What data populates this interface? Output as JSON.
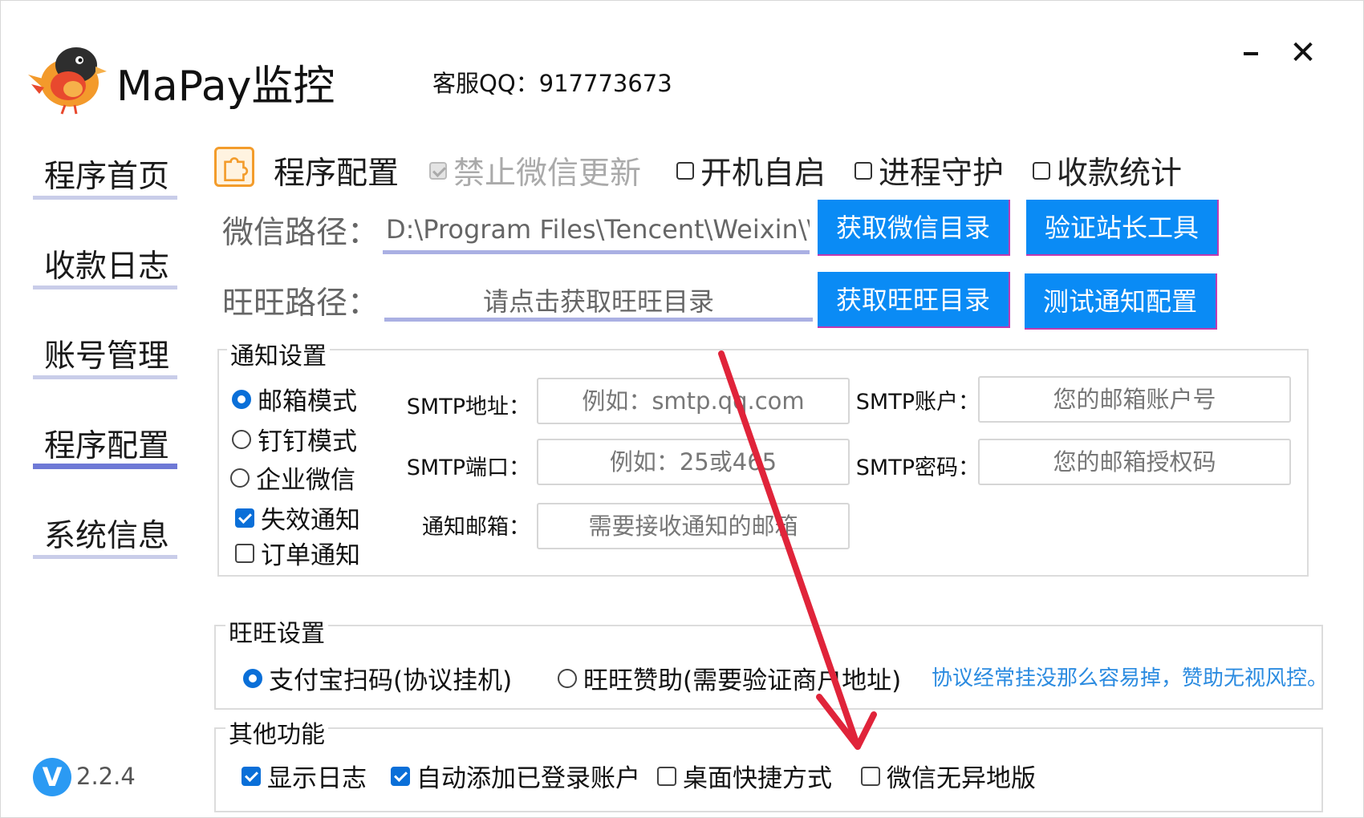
{
  "header": {
    "app_title": "MaPay监控",
    "qq": "客服QQ：917773673"
  },
  "sidebar": {
    "items": [
      {
        "label": "程序首页"
      },
      {
        "label": "收款日志"
      },
      {
        "label": "账号管理"
      },
      {
        "label": "程序配置",
        "active": true
      },
      {
        "label": "系统信息"
      }
    ],
    "version": "2.2.4",
    "version_icon": "V"
  },
  "config": {
    "title": "程序配置",
    "top_options": [
      {
        "label": "禁止微信更新",
        "checked": true,
        "disabled": true
      },
      {
        "label": "开机自启",
        "checked": false
      },
      {
        "label": "进程守护",
        "checked": false
      },
      {
        "label": "收款统计",
        "checked": false
      }
    ],
    "wechat_path_label": "微信路径：",
    "wechat_path_value": "D:\\Program Files\\Tencent\\Weixin\\\\",
    "wangwang_path_label": "旺旺路径：",
    "wangwang_path_placeholder": "请点击获取旺旺目录",
    "buttons": {
      "get_wechat_dir": "获取微信目录",
      "verify_tool": "验证站长工具",
      "get_wangwang_dir": "获取旺旺目录",
      "test_notify": "测试通知配置"
    }
  },
  "notify": {
    "title": "通知设置",
    "modes": [
      {
        "label": "邮箱模式",
        "selected": true
      },
      {
        "label": "钉钉模式",
        "selected": false
      },
      {
        "label": "企业微信",
        "selected": false
      }
    ],
    "checks": [
      {
        "label": "失效通知",
        "checked": true
      },
      {
        "label": "订单通知",
        "checked": false
      }
    ],
    "fields": {
      "smtp_addr_label": "SMTP地址：",
      "smtp_addr_placeholder": "例如：smtp.qq.com",
      "smtp_port_label": "SMTP端口：",
      "smtp_port_placeholder": "例如：25或465",
      "notify_mail_label": "通知邮箱：",
      "notify_mail_placeholder": "需要接收通知的邮箱",
      "smtp_account_label": "SMTP账户：",
      "smtp_account_placeholder": "您的邮箱账户号",
      "smtp_password_label": "SMTP密码：",
      "smtp_password_placeholder": "您的邮箱授权码"
    }
  },
  "wangwang": {
    "title": "旺旺设置",
    "options": [
      {
        "label": "支付宝扫码(协议挂机)",
        "selected": true
      },
      {
        "label": "旺旺赞助(需要验证商户地址)",
        "selected": false
      }
    ],
    "note": "协议经常挂没那么容易掉，赞助无视风控。"
  },
  "other": {
    "title": "其他功能",
    "options": [
      {
        "label": "显示日志",
        "checked": true
      },
      {
        "label": "自动添加已登录账户",
        "checked": true
      },
      {
        "label": "桌面快捷方式",
        "checked": false
      },
      {
        "label": "微信无异地版",
        "checked": false
      }
    ]
  },
  "colors": {
    "accent_blue": "#0a8bf5",
    "arrow_red": "#e0243a",
    "nav_active": "#6e79d6"
  }
}
